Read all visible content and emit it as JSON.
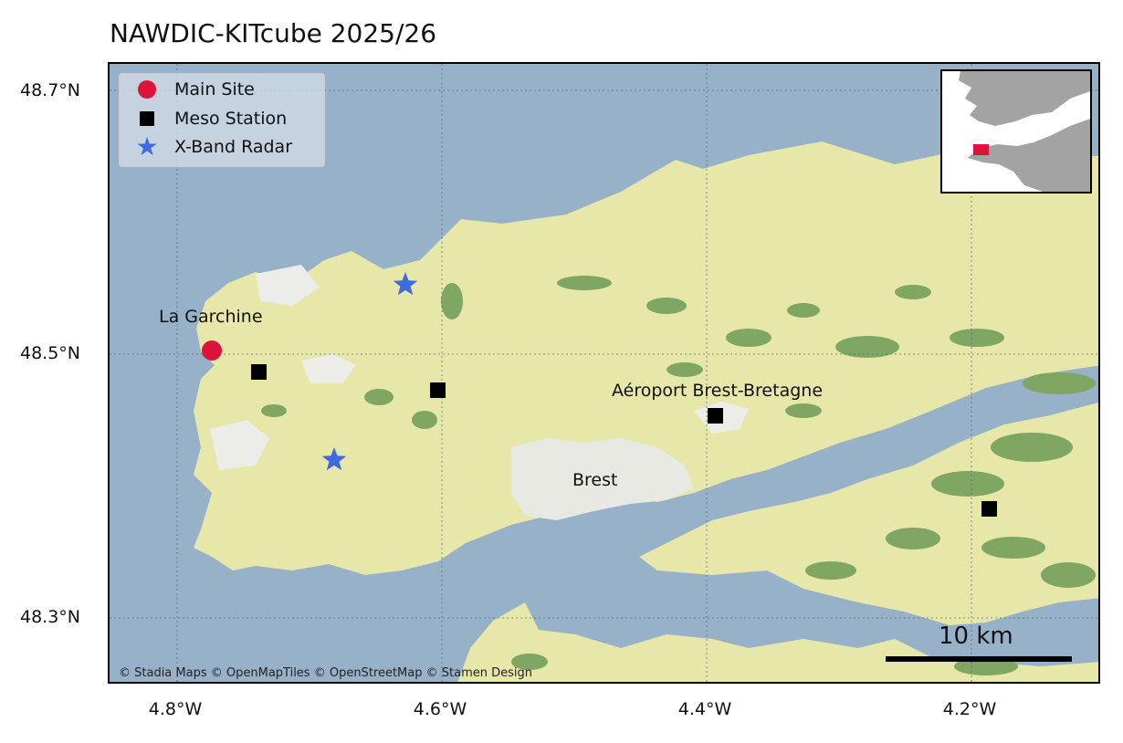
{
  "title": "NAWDIC-KITcube 2025/26",
  "legend": [
    {
      "label": "Main Site",
      "symbol": "circle-marker",
      "color": "#dc143c"
    },
    {
      "label": "Meso Station",
      "symbol": "square-marker",
      "color": "#000000"
    },
    {
      "label": "X-Band Radar",
      "symbol": "star-marker",
      "color": "#4169e1"
    }
  ],
  "axes": {
    "lat_ticks": [
      "48.7°N",
      "48.5°N",
      "48.3°N"
    ],
    "lon_ticks": [
      "4.8°W",
      "4.6°W",
      "4.4°W",
      "4.2°W"
    ]
  },
  "place_labels": {
    "la_garchine": "La Garchine",
    "aeroport": "Aéroport Brest-Bretagne",
    "brest": "Brest"
  },
  "scale": {
    "label": "10 km"
  },
  "attribution": "© Stadia Maps © OpenMapTiles © OpenStreetMap © Stamen Design",
  "colors": {
    "sea": "#97b1c9",
    "land": "#e6e7a8",
    "forest": "#7fa663",
    "urban": "#e7e7e3",
    "main_site": "#dc143c",
    "meso_station": "#000000",
    "x_band_radar": "#4169e1",
    "inset_land": "#a3a3a3"
  }
}
